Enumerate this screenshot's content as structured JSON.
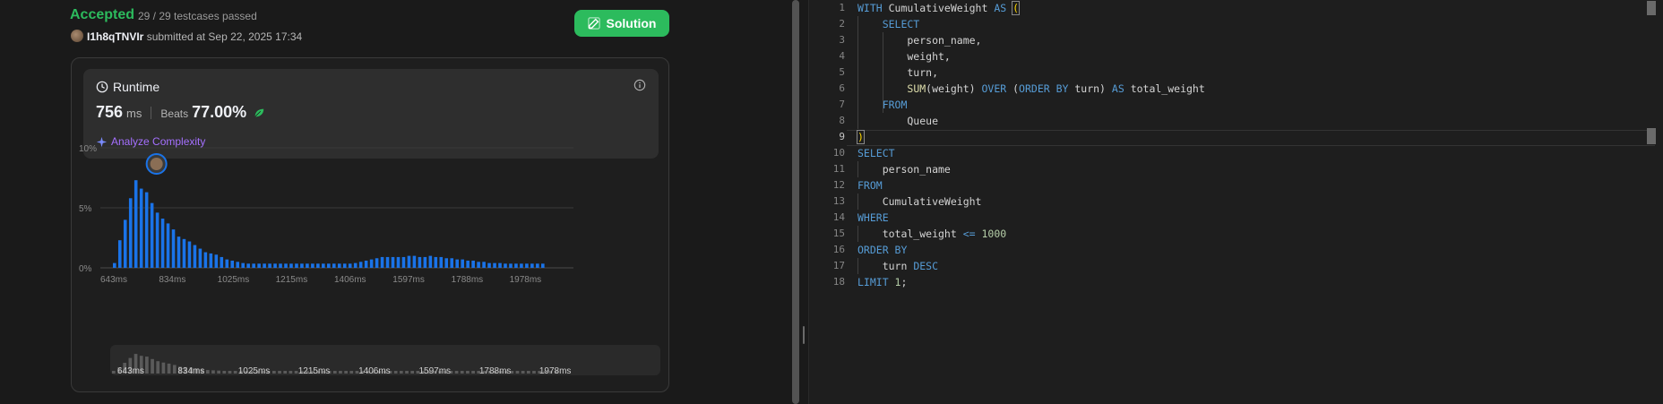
{
  "submission": {
    "status": "Accepted",
    "testcases": "29 / 29 testcases passed",
    "username": "I1h8qTNVIr",
    "submitted_prefix": "submitted at",
    "submitted_at": "Sep 22, 2025 17:34",
    "solution_button": "Solution",
    "colors": {
      "accepted": "#2cbb5d",
      "accent_purple": "#a570ff",
      "bar_blue": "#1a73e8"
    }
  },
  "runtime": {
    "title": "Runtime",
    "value": "756",
    "unit": "ms",
    "beats_label": "Beats",
    "beats_value": "77.00%",
    "analyze_label": "Analyze Complexity",
    "icons": [
      "clock-icon",
      "info-icon",
      "leaf-icon",
      "sparkle-icon",
      "pencil-icon"
    ]
  },
  "chart_data": {
    "type": "bar",
    "title": "",
    "xlabel": "",
    "ylabel": "",
    "ylim": [
      0,
      10
    ],
    "y_ticks": [
      "10%",
      "5%",
      "0%"
    ],
    "x_ticks": [
      "643ms",
      "834ms",
      "1025ms",
      "1215ms",
      "1406ms",
      "1597ms",
      "1788ms",
      "1978ms"
    ],
    "x_range_ms": [
      643,
      2140
    ],
    "marker_ms": 756,
    "grid": true,
    "series": [
      {
        "values": [
          0.4,
          2.3,
          4.0,
          5.8,
          7.3,
          6.6,
          6.3,
          5.4,
          4.6,
          4.1,
          3.7,
          3.2,
          2.6,
          2.4,
          2.2,
          1.9,
          1.6,
          1.3,
          1.2,
          1.1,
          0.9,
          0.7,
          0.6,
          0.5,
          0.4,
          0.35,
          0.35,
          0.35,
          0.35,
          0.35,
          0.35,
          0.35,
          0.35,
          0.35,
          0.35,
          0.35,
          0.35,
          0.35,
          0.35,
          0.35,
          0.35,
          0.35,
          0.35,
          0.35,
          0.35,
          0.4,
          0.5,
          0.6,
          0.7,
          0.8,
          0.9,
          0.9,
          0.9,
          0.9,
          0.9,
          1.0,
          1.0,
          0.9,
          0.9,
          1.0,
          0.9,
          0.9,
          0.8,
          0.8,
          0.7,
          0.7,
          0.6,
          0.6,
          0.5,
          0.5,
          0.4,
          0.4,
          0.4,
          0.35,
          0.35,
          0.35,
          0.35,
          0.35,
          0.35,
          0.35,
          0.35
        ]
      }
    ]
  },
  "editor": {
    "line_numbers": [
      "1",
      "2",
      "3",
      "4",
      "5",
      "6",
      "7",
      "8",
      "9",
      "10",
      "11",
      "12",
      "13",
      "14",
      "15",
      "16",
      "17",
      "18"
    ],
    "current_line": 9,
    "lines": [
      [
        {
          "t": "WITH ",
          "c": "kw"
        },
        {
          "t": "CumulativeWeight ",
          "c": ""
        },
        {
          "t": "AS ",
          "c": "kw"
        },
        {
          "t": "(",
          "c": "br"
        }
      ],
      [
        {
          "t": "    SELECT",
          "c": "kw"
        }
      ],
      [
        {
          "t": "        person_name,",
          "c": ""
        }
      ],
      [
        {
          "t": "        weight,",
          "c": ""
        }
      ],
      [
        {
          "t": "        turn,",
          "c": ""
        }
      ],
      [
        {
          "t": "        ",
          "c": ""
        },
        {
          "t": "SUM",
          "c": "fn"
        },
        {
          "t": "(weight) ",
          "c": ""
        },
        {
          "t": "OVER ",
          "c": "kw"
        },
        {
          "t": "(",
          "c": ""
        },
        {
          "t": "ORDER BY ",
          "c": "kw"
        },
        {
          "t": "turn) ",
          "c": ""
        },
        {
          "t": "AS ",
          "c": "kw"
        },
        {
          "t": "total_weight",
          "c": ""
        }
      ],
      [
        {
          "t": "    FROM",
          "c": "kw"
        }
      ],
      [
        {
          "t": "        Queue",
          "c": ""
        }
      ],
      [
        {
          "t": ")",
          "c": "br"
        }
      ],
      [
        {
          "t": "SELECT",
          "c": "kw"
        }
      ],
      [
        {
          "t": "    person_name",
          "c": ""
        }
      ],
      [
        {
          "t": "FROM",
          "c": "kw"
        }
      ],
      [
        {
          "t": "    CumulativeWeight",
          "c": ""
        }
      ],
      [
        {
          "t": "WHERE",
          "c": "kw"
        }
      ],
      [
        {
          "t": "    total_weight ",
          "c": ""
        },
        {
          "t": "<= ",
          "c": "kw"
        },
        {
          "t": "1000",
          "c": "num"
        }
      ],
      [
        {
          "t": "ORDER BY",
          "c": "kw"
        }
      ],
      [
        {
          "t": "    turn ",
          "c": ""
        },
        {
          "t": "DESC",
          "c": "kw"
        }
      ],
      [
        {
          "t": "LIMIT ",
          "c": "kw"
        },
        {
          "t": "1",
          "c": "num"
        },
        {
          "t": ";",
          "c": ""
        }
      ]
    ]
  }
}
